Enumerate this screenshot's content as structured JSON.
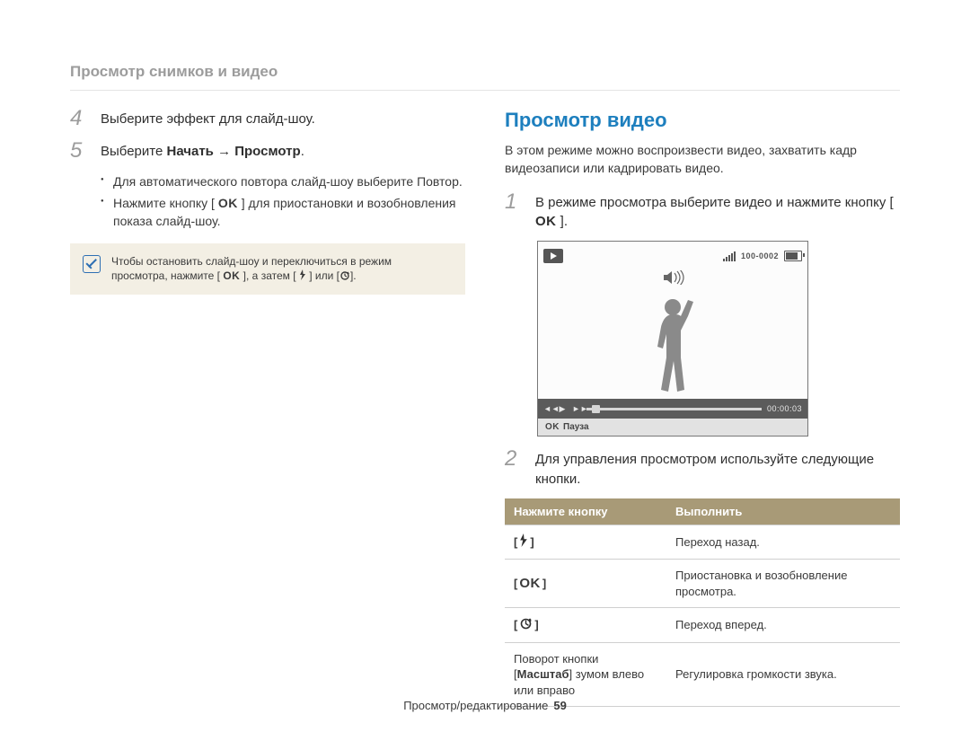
{
  "breadcrumb": "Просмотр снимков и видео",
  "left": {
    "step4_num": "4",
    "step4_text": "Выберите эффект для слайд-шоу.",
    "step5_num": "5",
    "step5_text_prefix": "Выберите ",
    "step5_text_bold": "Начать → Просмотр",
    "step5_text_suffix": ".",
    "bullet1_prefix": "Для автоматического повтора слайд-шоу выберите ",
    "bullet1_bold": "Повтор",
    "bullet1_suffix": ".",
    "bullet2_prefix": "Нажмите кнопку [ ",
    "bullet2_ok": "OK",
    "bullet2_suffix": " ] для приостановки и возобновления показа слайд-шоу.",
    "note_line1": "Чтобы остановить слайд-шоу и переключиться в режим",
    "note_line2_a": "просмотра, нажмите [ ",
    "note_line2_ok": "OK",
    "note_line2_b": " ], а затем [ ",
    "note_line2_c": " ] или [",
    "note_line2_d": "]."
  },
  "right": {
    "heading": "Просмотр видео",
    "intro": "В этом режиме можно воспроизвести видео, захватить кадр видеозаписи или кадрировать видео.",
    "step1_num": "1",
    "step1_text_a": "В режиме просмотра выберите видео и нажмите кнопку [ ",
    "step1_ok": "OK",
    "step1_text_b": " ].",
    "preview": {
      "top_label": "100-0002",
      "time": "00:00:03",
      "caption_ok": "OK",
      "caption_text": "Пауза"
    },
    "step2_num": "2",
    "step2_text": "Для управления просмотром используйте следующие кнопки.",
    "table": {
      "head_left": "Нажмите кнопку",
      "head_right": "Выполнить",
      "rows": [
        {
          "btn_type": "flash",
          "action": "Переход назад."
        },
        {
          "btn_type": "ok",
          "action": "Приостановка и возобновление просмотра."
        },
        {
          "btn_type": "timer",
          "action": "Переход вперед."
        },
        {
          "btn_type": "text",
          "btn_text_a": "Поворот кнопки [",
          "btn_text_bold": "Масштаб",
          "btn_text_b": "] зумом влево или вправо",
          "action": "Регулировка громкости звука."
        }
      ],
      "ok_label": "OK"
    }
  },
  "footer": {
    "label": "Просмотр/редактирование",
    "page": "59"
  }
}
